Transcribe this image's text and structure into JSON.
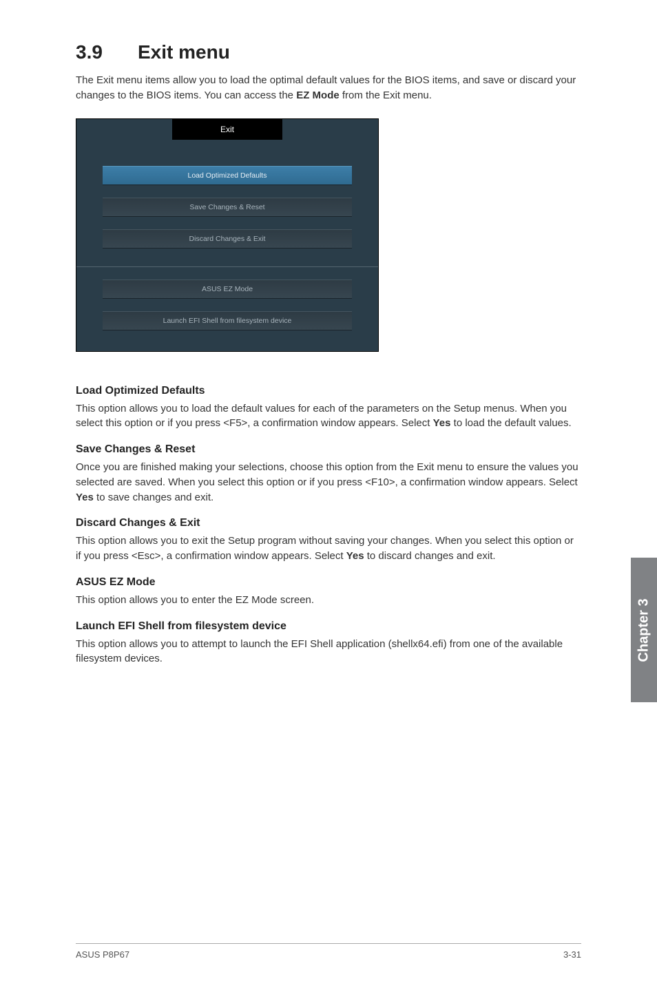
{
  "header": {
    "section_number": "3.9",
    "section_title": "Exit menu"
  },
  "intro": {
    "text_part1": "The Exit menu items allow you to load the optimal default values for the BIOS items, and save or discard your changes to the BIOS items. You can access the ",
    "bold": "EZ Mode",
    "text_part2": " from the Exit menu."
  },
  "bios": {
    "tab": "Exit",
    "buttons": {
      "load_defaults": "Load Optimized Defaults",
      "save_reset": "Save Changes & Reset",
      "discard_exit": "Discard Changes & Exit",
      "ez_mode": "ASUS EZ Mode",
      "launch_efi": "Launch EFI Shell from filesystem device"
    }
  },
  "sections": {
    "load_defaults": {
      "heading": "Load Optimized Defaults",
      "p1": "This option allows you to load the default values for each of the parameters on the Setup menus. When you select this option or if you press <F5>, a confirmation window appears. Select ",
      "bold": "Yes",
      "p2": " to load the default values."
    },
    "save_reset": {
      "heading": "Save Changes & Reset",
      "p1": "Once you are finished making your selections, choose this option from the Exit menu to ensure the values you selected are saved. When you select this option or if you press <F10>, a confirmation window appears. Select ",
      "bold": "Yes",
      "p2": " to save changes and exit."
    },
    "discard_exit": {
      "heading": "Discard Changes & Exit",
      "p1": "This option allows you to exit the Setup program without saving your changes. When you select this option or if you press <Esc>, a confirmation window appears. Select ",
      "bold": "Yes",
      "p2": " to discard changes and exit."
    },
    "ez_mode": {
      "heading": "ASUS EZ Mode",
      "p": "This option allows you to enter the EZ Mode screen."
    },
    "launch_efi": {
      "heading": "Launch EFI Shell from filesystem device",
      "p": "This option allows you to attempt to launch the EFI Shell application (shellx64.efi) from one of the available filesystem devices."
    }
  },
  "side_tab": "Chapter 3",
  "footer": {
    "left": "ASUS P8P67",
    "right": "3-31"
  }
}
